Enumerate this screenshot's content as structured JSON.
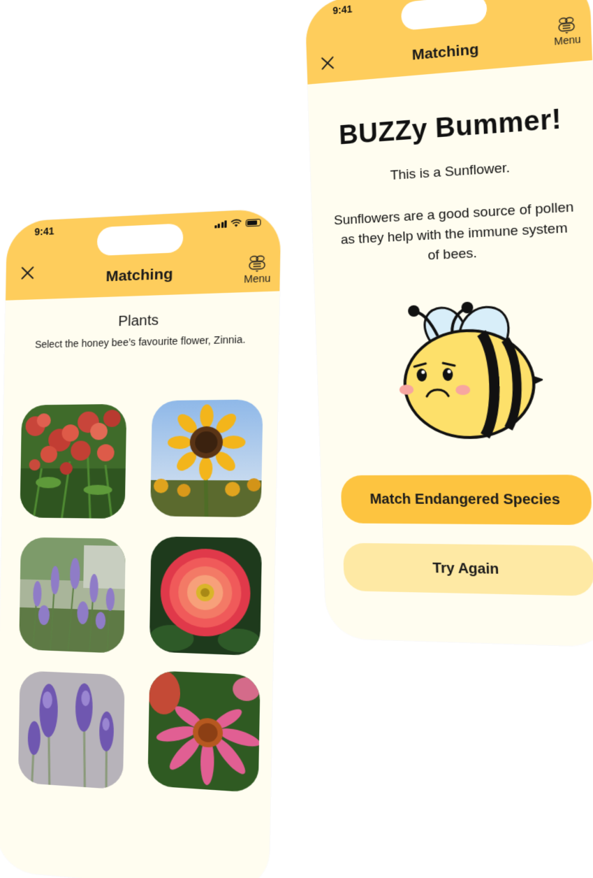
{
  "status_bar": {
    "time": "9:41"
  },
  "left_screen": {
    "nav": {
      "title": "Matching",
      "menu_label": "Menu"
    },
    "section_title": "Plants",
    "instruction": "Select the honey bee’s favourite flower, Zinnia.",
    "options": [
      {
        "name": "red-milkweed",
        "icon": "flower-photo"
      },
      {
        "name": "sunflower",
        "icon": "flower-photo"
      },
      {
        "name": "catmint",
        "icon": "flower-photo"
      },
      {
        "name": "zinnia",
        "icon": "flower-photo"
      },
      {
        "name": "lavender",
        "icon": "flower-photo"
      },
      {
        "name": "coneflower",
        "icon": "flower-photo"
      }
    ]
  },
  "right_screen": {
    "nav": {
      "title": "Matching",
      "menu_label": "Menu"
    },
    "headline": "BUZZy Bummer!",
    "identified": "This is a Sunflower.",
    "fact": "Sunflowers are a good source of pollen as they help with the immune system of bees.",
    "primary_button": "Match Endangered Species",
    "secondary_button": "Try Again"
  },
  "colors": {
    "header": "#fecd5c",
    "background": "#fffdf0",
    "primary_button": "#fdc440",
    "secondary_button": "#fee9a4"
  }
}
